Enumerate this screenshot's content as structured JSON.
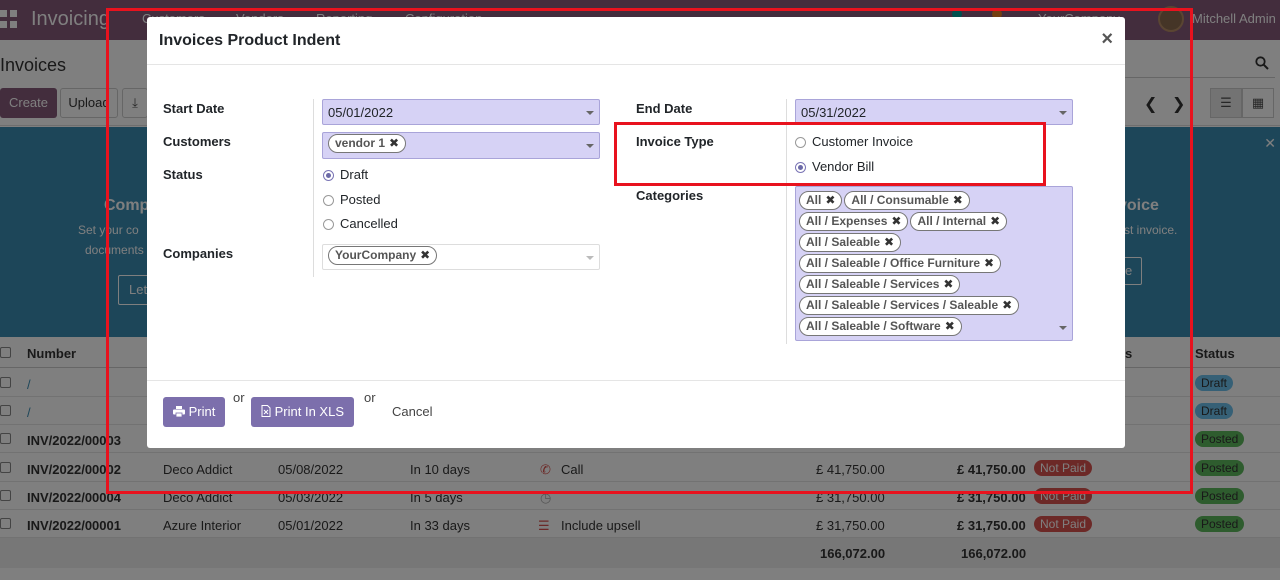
{
  "topbar": {
    "app_name": "Invoicing",
    "menu": [
      "Customers",
      "Vendors",
      "Reporting",
      "Configuration"
    ],
    "company": "YourCompany",
    "user": "Mitchell Admin"
  },
  "control_panel": {
    "breadcrumb": "Invoices",
    "create_label": "Create",
    "upload_label": "Upload"
  },
  "banner": {
    "left_title": "Comp",
    "left_sub1": "Set your co",
    "left_sub2": "documents",
    "left_btn": "Let",
    "right_title": "voice",
    "right_sub": "st invoice.",
    "right_btn": "e"
  },
  "table": {
    "headers": {
      "number": "Number",
      "status": "Status",
      "payment": "s"
    },
    "rows": [
      {
        "number": "/",
        "customer": "",
        "date": "",
        "due": "",
        "activity": "",
        "untaxed": "",
        "total": "",
        "payment": "",
        "status": "Draft"
      },
      {
        "number": "/",
        "customer": "",
        "date": "",
        "due": "",
        "activity": "",
        "untaxed": "",
        "total": "",
        "payment": "",
        "status": "Draft"
      },
      {
        "number": "INV/2022/00003",
        "customer": "",
        "date": "",
        "due": "",
        "activity": "",
        "untaxed": "",
        "total": "",
        "payment": "",
        "status": "Posted"
      },
      {
        "number": "INV/2022/00002",
        "customer": "Deco Addict",
        "date": "05/08/2022",
        "due": "In 10 days",
        "activity": "Call",
        "untaxed": "£ 41,750.00",
        "total": "£ 41,750.00",
        "payment": "Not Paid",
        "status": "Posted"
      },
      {
        "number": "INV/2022/00004",
        "customer": "Deco Addict",
        "date": "05/03/2022",
        "due": "In 5 days",
        "activity": "",
        "untaxed": "£ 31,750.00",
        "total": "£ 31,750.00",
        "payment": "Not Paid",
        "status": "Posted"
      },
      {
        "number": "INV/2022/00001",
        "customer": "Azure Interior",
        "date": "05/01/2022",
        "due": "In 33 days",
        "activity": "Include upsell",
        "untaxed": "£ 31,750.00",
        "total": "£ 31,750.00",
        "payment": "Not Paid",
        "status": "Posted"
      }
    ],
    "footer": {
      "untaxed_total": "166,072.00",
      "total": "166,072.00"
    }
  },
  "modal": {
    "title": "Invoices Product Indent",
    "close_glyph": "×",
    "start_date_label": "Start Date",
    "start_date_value": "05/01/2022",
    "end_date_label": "End Date",
    "end_date_value": "05/31/2022",
    "customers_label": "Customers",
    "customers_tags": [
      "vendor 1"
    ],
    "status_label": "Status",
    "status_options": [
      "Draft",
      "Posted",
      "Cancelled"
    ],
    "status_selected": "Draft",
    "invoice_type_label": "Invoice Type",
    "invoice_type_options": [
      "Customer Invoice",
      "Vendor Bill"
    ],
    "invoice_type_selected": "Vendor Bill",
    "companies_label": "Companies",
    "companies_tags": [
      "YourCompany"
    ],
    "categories_label": "Categories",
    "categories_tags": [
      "All",
      "All / Consumable",
      "All / Expenses",
      "All / Internal",
      "All / Saleable",
      "All / Saleable / Office Furniture",
      "All / Saleable / Services",
      "All / Saleable / Services / Saleable",
      "All / Saleable / Software"
    ],
    "tag_remove_glyph": "✖",
    "print_label": "Print",
    "print_xls_label": "Print In XLS",
    "or_label": "or",
    "cancel_label": "Cancel"
  },
  "colors": {
    "brand": "#875a7b",
    "field_bg": "#d6d2f5",
    "primary_button": "#7c6fac",
    "highlight": "#e8121e"
  }
}
